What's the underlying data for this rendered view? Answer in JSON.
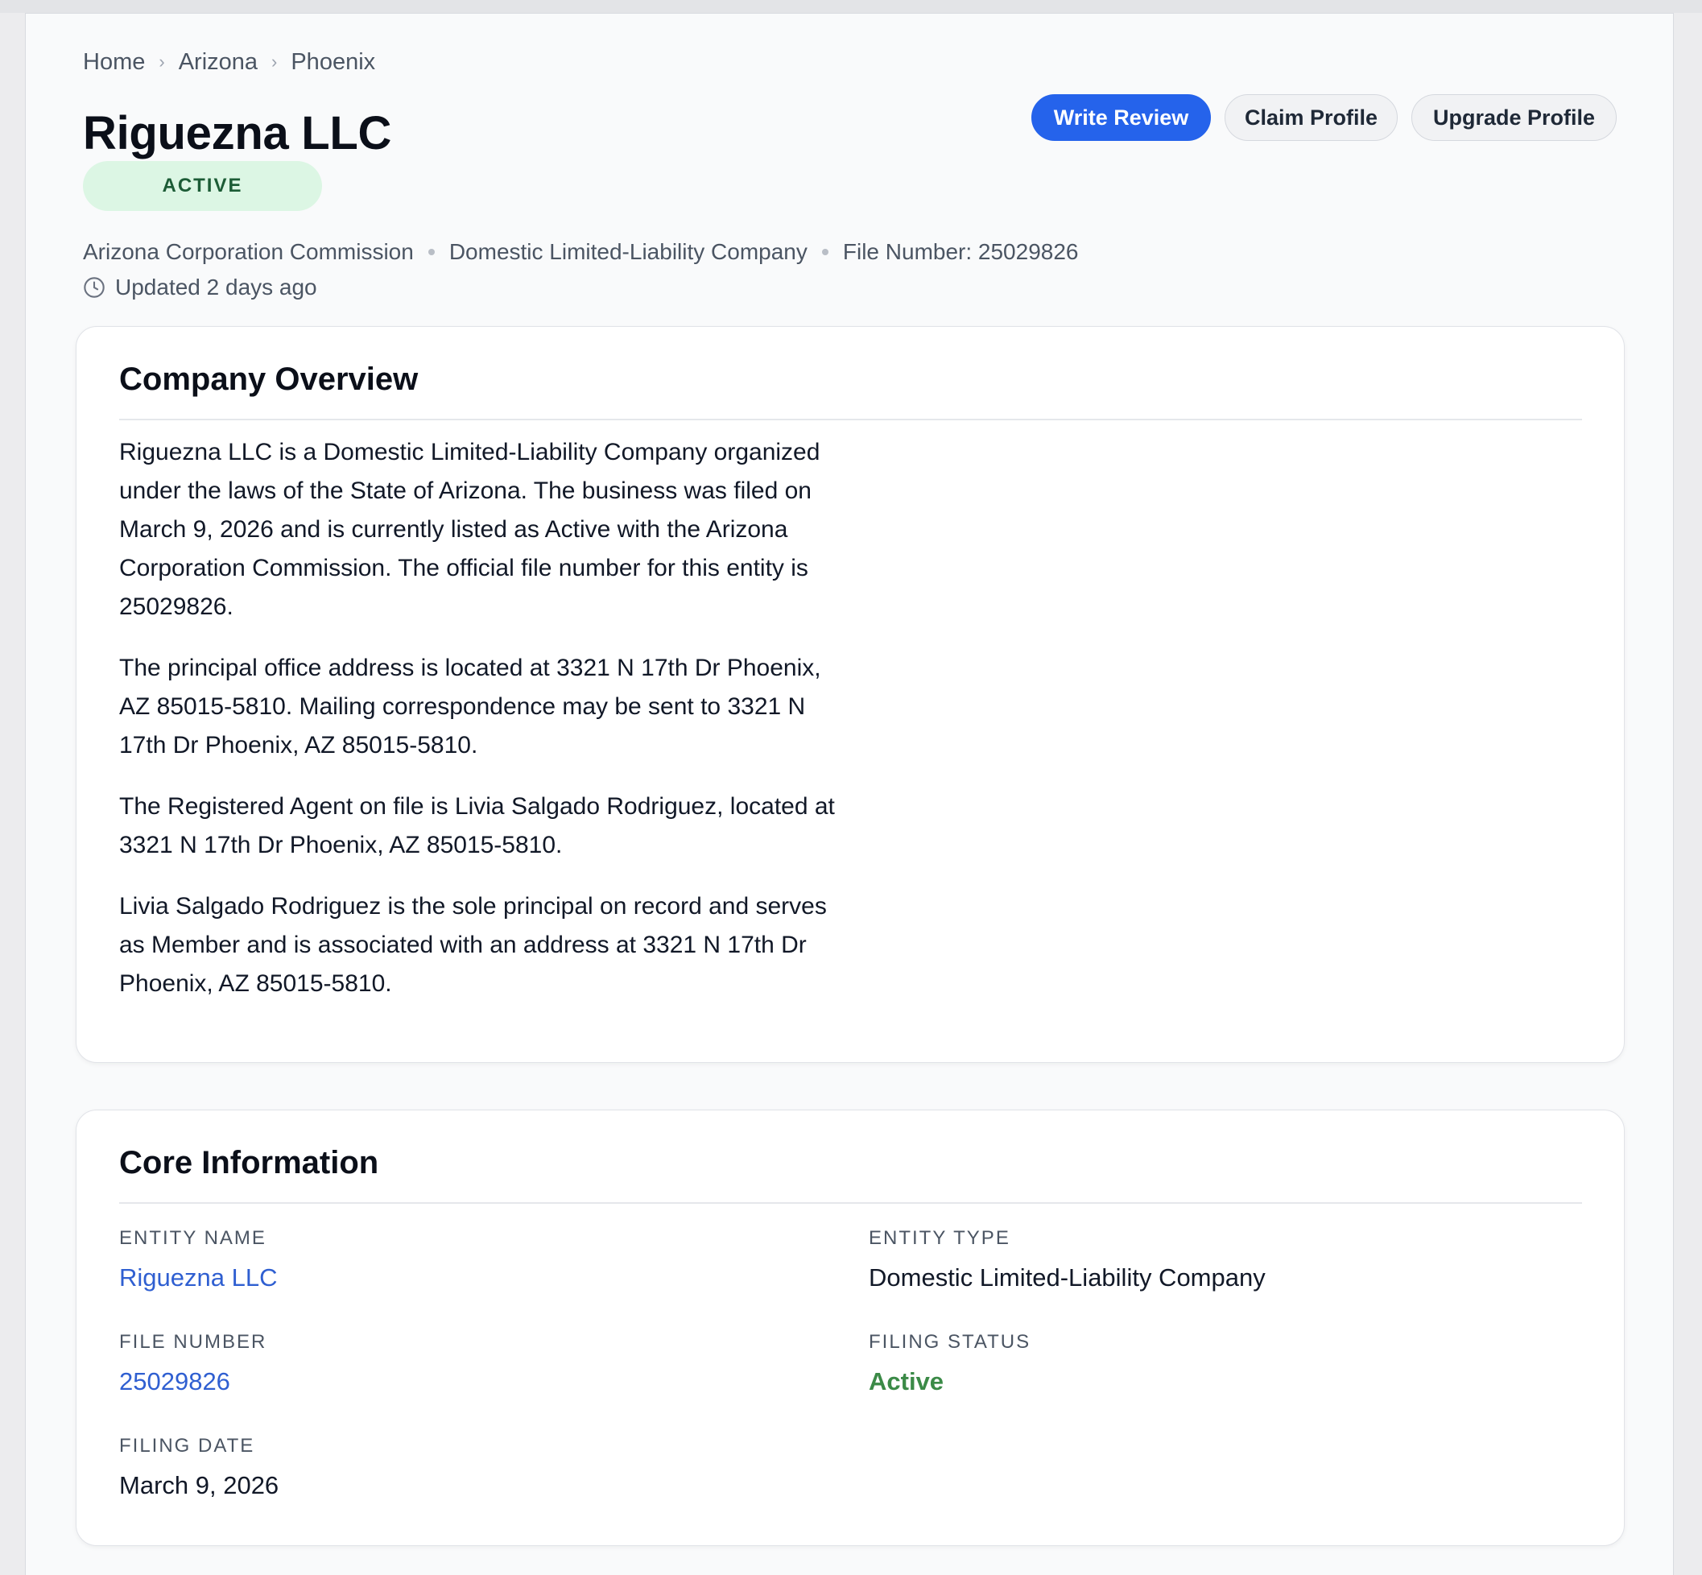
{
  "breadcrumb": {
    "items": [
      "Home",
      "Arizona",
      "Phoenix"
    ],
    "separator": "›"
  },
  "header": {
    "title": "Riguezna LLC",
    "status_badge": "ACTIVE",
    "meta": {
      "agency": "Arizona Corporation Commission",
      "entity_type": "Domestic Limited-Liability Company",
      "file_number": "File Number: 25029826"
    },
    "updated": "Updated 2 days ago"
  },
  "actions": {
    "write_review": "Write Review",
    "claim_profile": "Claim Profile",
    "upgrade_profile": "Upgrade Profile"
  },
  "overview": {
    "heading": "Company Overview",
    "paragraphs": [
      "Riguezna LLC is a Domestic Limited-Liability Company organized under the laws of the State of Arizona. The business was filed on March 9, 2026 and is currently listed as Active with the Arizona Corporation Commission. The official file number for this entity is 25029826.",
      "The principal office address is located at 3321 N 17th Dr Phoenix, AZ 85015-5810. Mailing correspondence may be sent to 3321 N 17th Dr Phoenix, AZ 85015-5810.",
      "The Registered Agent on file is Livia Salgado Rodriguez, located at 3321 N 17th Dr Phoenix, AZ 85015-5810.",
      "Livia Salgado Rodriguez is the sole principal on record and serves as Member and is associated with an address at 3321 N 17th Dr Phoenix, AZ 85015-5810."
    ]
  },
  "core": {
    "heading": "Core Information",
    "entity_name_label": "ENTITY NAME",
    "entity_name": "Riguezna LLC",
    "entity_type_label": "ENTITY TYPE",
    "entity_type": "Domestic Limited-Liability Company",
    "file_number_label": "FILE NUMBER",
    "file_number": "25029826",
    "filing_status_label": "FILING STATUS",
    "filing_status": "Active",
    "filing_date_label": "FILING DATE",
    "filing_date": "March 9, 2026"
  },
  "colors": {
    "primary": "#2563eb",
    "link": "#2f5fd1",
    "active_text": "#3b8a47",
    "badge_bg": "#dcf6e4",
    "badge_text": "#1c5c36"
  },
  "icons": {
    "breadcrumb_separator": "chevron-right-icon",
    "updated": "clock-icon"
  }
}
